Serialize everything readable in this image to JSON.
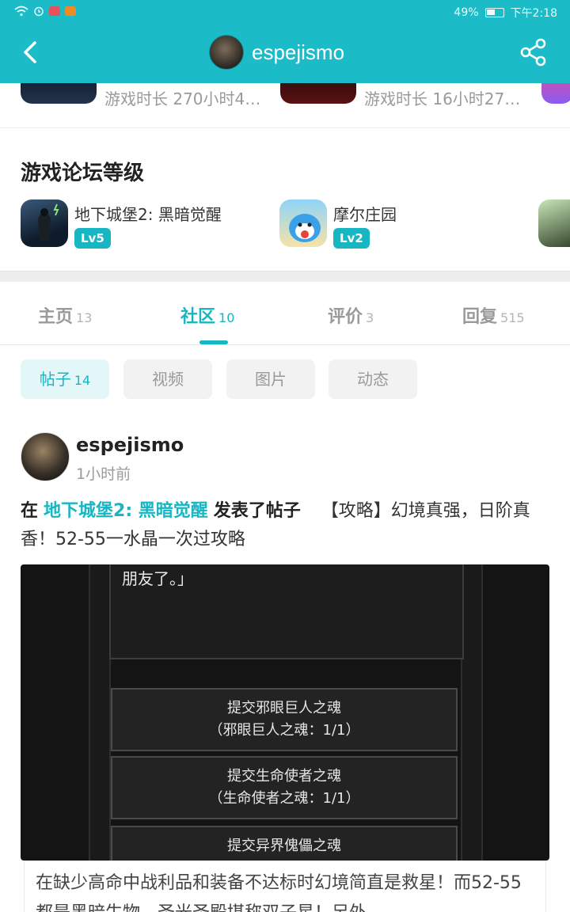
{
  "status_bar": {
    "battery": "49%",
    "time": "下午2:18"
  },
  "header": {
    "username": "espejismo"
  },
  "played_games": [
    {
      "playtime": "游戏时长 270小时4…"
    },
    {
      "playtime": "游戏时长 16小时27…"
    }
  ],
  "forum_level": {
    "title": "游戏论坛等级",
    "items": [
      {
        "name": "地下城堡2: 黑暗觉醒",
        "level": "Lv5"
      },
      {
        "name": "摩尔庄园",
        "level": "Lv2"
      }
    ]
  },
  "tabs": [
    {
      "label": "主页",
      "count": "13"
    },
    {
      "label": "社区",
      "count": "10"
    },
    {
      "label": "评价",
      "count": "3"
    },
    {
      "label": "回复",
      "count": "515"
    }
  ],
  "filters": [
    {
      "label": "帖子",
      "count": "14"
    },
    {
      "label": "视频"
    },
    {
      "label": "图片"
    },
    {
      "label": "动态"
    }
  ],
  "post": {
    "author": "espejismo",
    "time": "1小时前",
    "prefix": "在",
    "game": "地下城堡2: 黑暗觉醒",
    "action": "发表了帖子",
    "title": "【攻略】幻境真强，日阶真香！52-55一水晶一次过攻略",
    "image": {
      "top_text": "朋友了。」",
      "buttons": [
        {
          "line1": "提交邪眼巨人之魂",
          "line2": "（邪眼巨人之魂：1/1）"
        },
        {
          "line1": "提交生命使者之魂",
          "line2": "（生命使者之魂：1/1）"
        },
        {
          "line1": "提交异界傀儡之魂",
          "line2": ""
        }
      ]
    },
    "body": "在缺少高命中战利品和装备不达标时幻境简直是救星！而52-55都是黑暗生物，圣光圣殿堪称双子星！另外"
  }
}
